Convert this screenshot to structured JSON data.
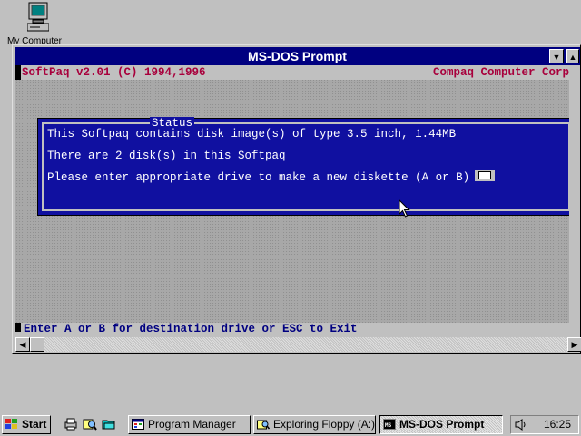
{
  "desktop": {
    "icons": [
      {
        "label": "My Computer",
        "icon": "my-computer-icon"
      }
    ]
  },
  "window": {
    "title": "MS-DOS Prompt",
    "dos": {
      "header_left": "SoftPaq v2.01 (C) 1994,1996",
      "header_right": "Compaq Computer Corp",
      "status_title": "Status",
      "line1": "This Softpaq contains disk image(s) of type 3.5 inch, 1.44MB",
      "line2": "There are 2 disk(s) in this Softpaq",
      "line3": "Please enter appropriate drive to make a new diskette (A or B)",
      "footer": "Enter A or B for destination drive or ESC to Exit"
    }
  },
  "taskbar": {
    "start_label": "Start",
    "buttons": [
      {
        "label": "Program Manager",
        "icon": "program-manager-icon"
      },
      {
        "label": "Exploring Floppy (A:)",
        "icon": "explorer-icon"
      },
      {
        "label": "MS-DOS Prompt",
        "icon": "msdos-icon",
        "active": true
      }
    ],
    "clock": "16:25"
  },
  "colors": {
    "title_bar": "#000080",
    "dos_dialog": "#1010a0",
    "header_text": "#a8003c",
    "footer_text": "#000080"
  }
}
